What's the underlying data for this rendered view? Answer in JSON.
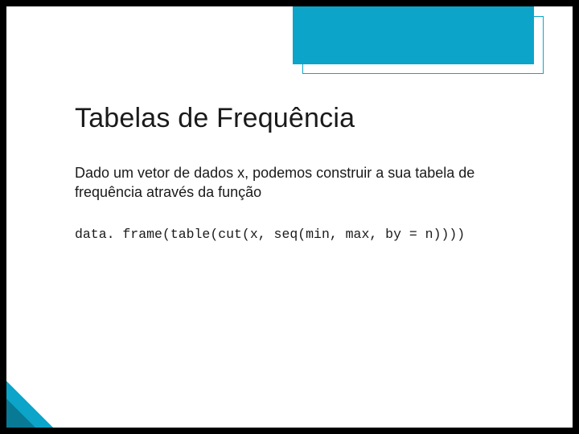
{
  "slide": {
    "title": "Tabelas de Frequência",
    "body": "Dado um vetor de dados x, podemos construir a sua tabela de frequência através da função",
    "code": "data. frame(table(cut(x, seq(min, max, by = n))))"
  },
  "colors": {
    "accent": "#0ca4c9",
    "accent_dark": "#087a96"
  }
}
